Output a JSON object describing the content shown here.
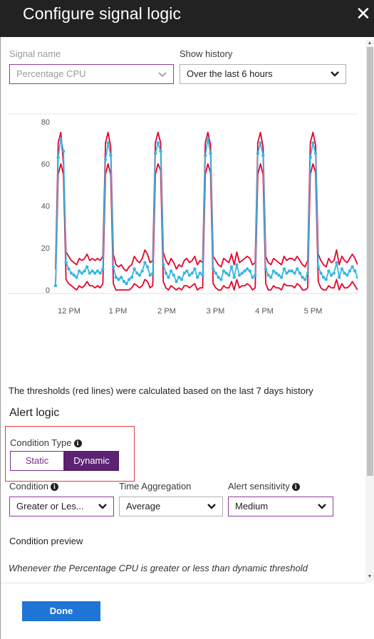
{
  "blade": {
    "title": "Configure signal logic",
    "close_glyph": "✕"
  },
  "signal": {
    "label": "Signal name",
    "value": "Percentage CPU"
  },
  "history": {
    "label": "Show history",
    "value": "Over the last 6 hours"
  },
  "chart_data": {
    "type": "line",
    "ylim": [
      0,
      80
    ],
    "yticks": [
      "80",
      "60",
      "40",
      "20",
      "0"
    ],
    "xticks": [
      "12 PM",
      "1 PM",
      "2 PM",
      "3 PM",
      "4 PM",
      "5 PM"
    ],
    "series": [
      {
        "values": [
          2,
          63,
          72,
          66,
          13,
          10,
          8,
          7,
          6,
          9,
          8,
          9,
          11,
          8,
          9,
          8,
          9,
          8,
          10,
          62,
          70,
          64,
          11,
          6,
          5,
          6,
          4,
          3,
          5,
          6,
          10,
          8,
          7,
          9,
          13,
          11,
          7,
          8,
          65,
          70,
          66,
          12,
          8,
          6,
          9,
          7,
          4,
          6,
          5,
          8,
          9,
          7,
          8,
          10,
          6,
          8,
          7,
          64,
          72,
          65,
          10,
          8,
          6,
          5,
          9,
          8,
          7,
          11,
          6,
          12,
          7,
          8,
          9,
          10,
          9,
          6,
          7,
          65,
          70,
          64,
          10,
          7,
          6,
          9,
          8,
          7,
          6,
          10,
          8,
          9,
          9,
          8,
          10,
          8,
          6,
          5,
          8,
          63,
          70,
          65,
          11,
          8,
          6,
          5,
          9,
          7,
          8,
          13,
          6,
          10,
          8,
          7,
          9,
          11,
          9,
          6
        ]
      },
      {
        "values": [
          10,
          70,
          75,
          60,
          18,
          16,
          14,
          13,
          12,
          15,
          14,
          15,
          17,
          14,
          15,
          14,
          15,
          14,
          16,
          70,
          75,
          68,
          17,
          12,
          11,
          12,
          10,
          9,
          11,
          12,
          16,
          14,
          13,
          15,
          19,
          17,
          13,
          14,
          70,
          75,
          70,
          18,
          14,
          12,
          15,
          13,
          10,
          12,
          11,
          14,
          15,
          13,
          14,
          16,
          12,
          14,
          13,
          70,
          75,
          69,
          16,
          14,
          12,
          11,
          15,
          14,
          13,
          17,
          12,
          18,
          13,
          14,
          15,
          16,
          15,
          12,
          13,
          70,
          75,
          68,
          16,
          13,
          12,
          15,
          14,
          13,
          12,
          16,
          14,
          15,
          15,
          14,
          16,
          14,
          12,
          11,
          14,
          70,
          75,
          69,
          17,
          14,
          12,
          11,
          15,
          13,
          14,
          19,
          12,
          16,
          14,
          13,
          15,
          17,
          15,
          12
        ]
      },
      {
        "values": [
          2,
          55,
          60,
          55,
          5,
          3,
          2,
          1,
          0,
          2,
          1,
          2,
          4,
          2,
          2,
          1,
          2,
          1,
          3,
          55,
          60,
          55,
          3,
          0,
          0,
          0,
          0,
          0,
          0,
          1,
          3,
          2,
          1,
          2,
          5,
          4,
          1,
          2,
          55,
          60,
          57,
          4,
          1,
          0,
          2,
          1,
          0,
          1,
          0,
          2,
          2,
          1,
          2,
          3,
          0,
          1,
          1,
          55,
          60,
          56,
          3,
          1,
          0,
          0,
          2,
          1,
          1,
          4,
          0,
          5,
          1,
          2,
          2,
          3,
          2,
          0,
          1,
          55,
          60,
          55,
          3,
          0,
          0,
          2,
          1,
          1,
          0,
          3,
          2,
          2,
          2,
          1,
          3,
          2,
          0,
          0,
          1,
          55,
          60,
          56,
          4,
          1,
          0,
          0,
          2,
          1,
          1,
          5,
          0,
          3,
          1,
          1,
          2,
          4,
          2,
          0
        ]
      }
    ]
  },
  "note": "The thresholds (red lines) were calculated based on the last 7 days history",
  "alert_logic": {
    "heading": "Alert logic"
  },
  "condition_type": {
    "label": "Condition Type",
    "options": [
      "Static",
      "Dynamic"
    ],
    "selected": "Dynamic"
  },
  "condition": {
    "label": "Condition",
    "value": "Greater or Les..."
  },
  "time_aggregation": {
    "label": "Time Aggregation",
    "value": "Average"
  },
  "sensitivity": {
    "label": "Alert sensitivity",
    "value": "Medium"
  },
  "preview": {
    "label": "Condition preview",
    "text": "Whenever the Percentage CPU is greater or less than dynamic threshold"
  },
  "footer": {
    "done_label": "Done"
  },
  "colors": {
    "threshold": "#e8002a",
    "metric": "#36b5e3",
    "dynamic_selected": "#5d2273",
    "primary": "#1f75d6",
    "highlight": "#e5393d"
  },
  "icons": {
    "close": "close-icon",
    "chevron": "chevron-down-icon",
    "info": "info-icon"
  }
}
